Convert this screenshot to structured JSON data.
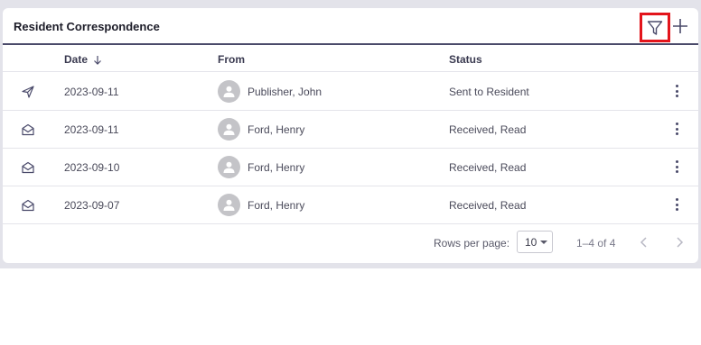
{
  "card": {
    "title": "Resident Correspondence",
    "actions": {
      "filter_icon": "filter-icon",
      "add_icon": "plus-icon"
    }
  },
  "table": {
    "columns": {
      "date": "Date",
      "from": "From",
      "status": "Status"
    },
    "sort_icon": "arrow-down-icon",
    "rows": [
      {
        "icon": "send-icon",
        "date": "2023-09-11",
        "from": "Publisher, John",
        "status": "Sent to Resident"
      },
      {
        "icon": "envelope-open-icon",
        "date": "2023-09-11",
        "from": "Ford, Henry",
        "status": "Received, Read"
      },
      {
        "icon": "envelope-open-icon",
        "date": "2023-09-10",
        "from": "Ford, Henry",
        "status": "Received, Read"
      },
      {
        "icon": "envelope-open-icon",
        "date": "2023-09-07",
        "from": "Ford, Henry",
        "status": "Received, Read"
      }
    ]
  },
  "pagination": {
    "rows_per_page_label": "Rows per page:",
    "rows_per_page_value": "10",
    "range": "1–4 of 4"
  },
  "colors": {
    "highlight": "#e3141b",
    "header_rule": "#4a4a6a",
    "backdrop": "#e3e3ea"
  }
}
